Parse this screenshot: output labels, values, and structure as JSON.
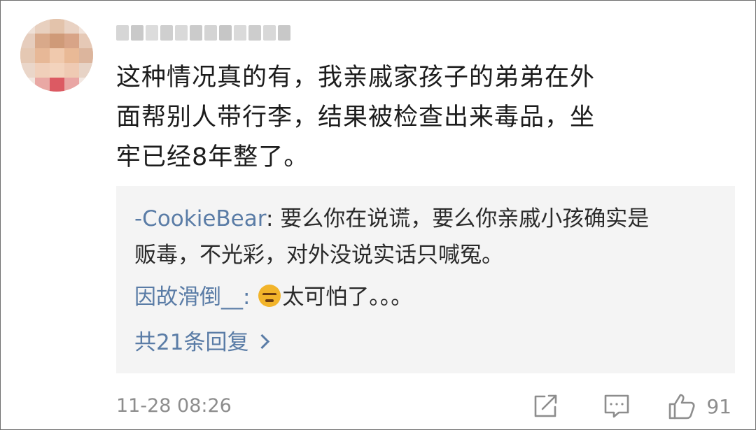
{
  "comment": {
    "username_blurred": true,
    "text_lines": [
      "这种情况真的有，我亲戚家孩子的弟弟在外",
      "面帮别人带行李，结果被检查出来毒品，坐",
      "牢已经8年整了。"
    ],
    "timestamp": "11-28 08:26",
    "like_count": "91"
  },
  "replies": [
    {
      "author": "-CookieBear",
      "separator": ": ",
      "text_lines": [
        "要么你在说谎，要么你亲戚小孩确实是",
        "贩毒，不光彩，对外没说实话只喊冤。"
      ]
    },
    {
      "author": "因故滑倒__",
      "separator": ": ",
      "emoji": "sweat-face-emoji",
      "text": "太可怕了。。。"
    }
  ],
  "more_replies_label": "共21条回复",
  "icons": {
    "share": "share-icon",
    "comment": "comment-icon",
    "like": "thumbs-up-icon"
  },
  "colors": {
    "author_link": "#5a7ca6",
    "body_text": "#1c1c1c",
    "meta_text": "#8d8d8d",
    "reply_background": "#f4f4f4"
  }
}
